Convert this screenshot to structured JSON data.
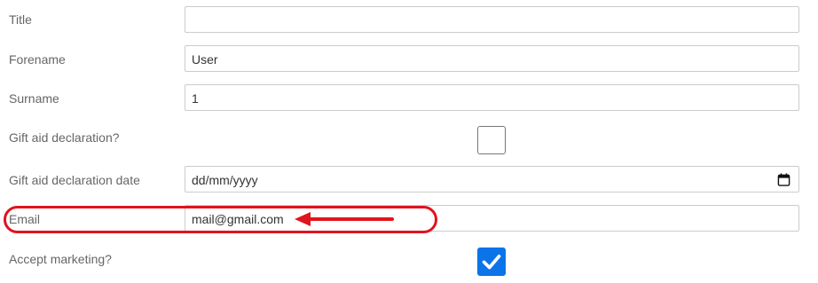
{
  "form": {
    "title": {
      "label": "Title",
      "value": ""
    },
    "forename": {
      "label": "Forename",
      "value": "User"
    },
    "surname": {
      "label": "Surname",
      "value": "1"
    },
    "gift_aid": {
      "label": "Gift aid declaration?",
      "checked": false
    },
    "gift_aid_date": {
      "label": "Gift aid declaration date",
      "value": "dd/mm/yyyy"
    },
    "email": {
      "label": "Email",
      "value": "mail@gmail.com"
    },
    "accept_marketing": {
      "label": "Accept marketing?",
      "checked": true
    }
  },
  "icons": {
    "date_picker": "calendar-icon",
    "checkmark": "checkmark-icon",
    "annotation_arrow": "arrow-left-icon"
  },
  "colors": {
    "annotation": "#e0141e",
    "checkbox_checked": "#0a74e8",
    "label": "#666666",
    "border": "#cccccc"
  }
}
